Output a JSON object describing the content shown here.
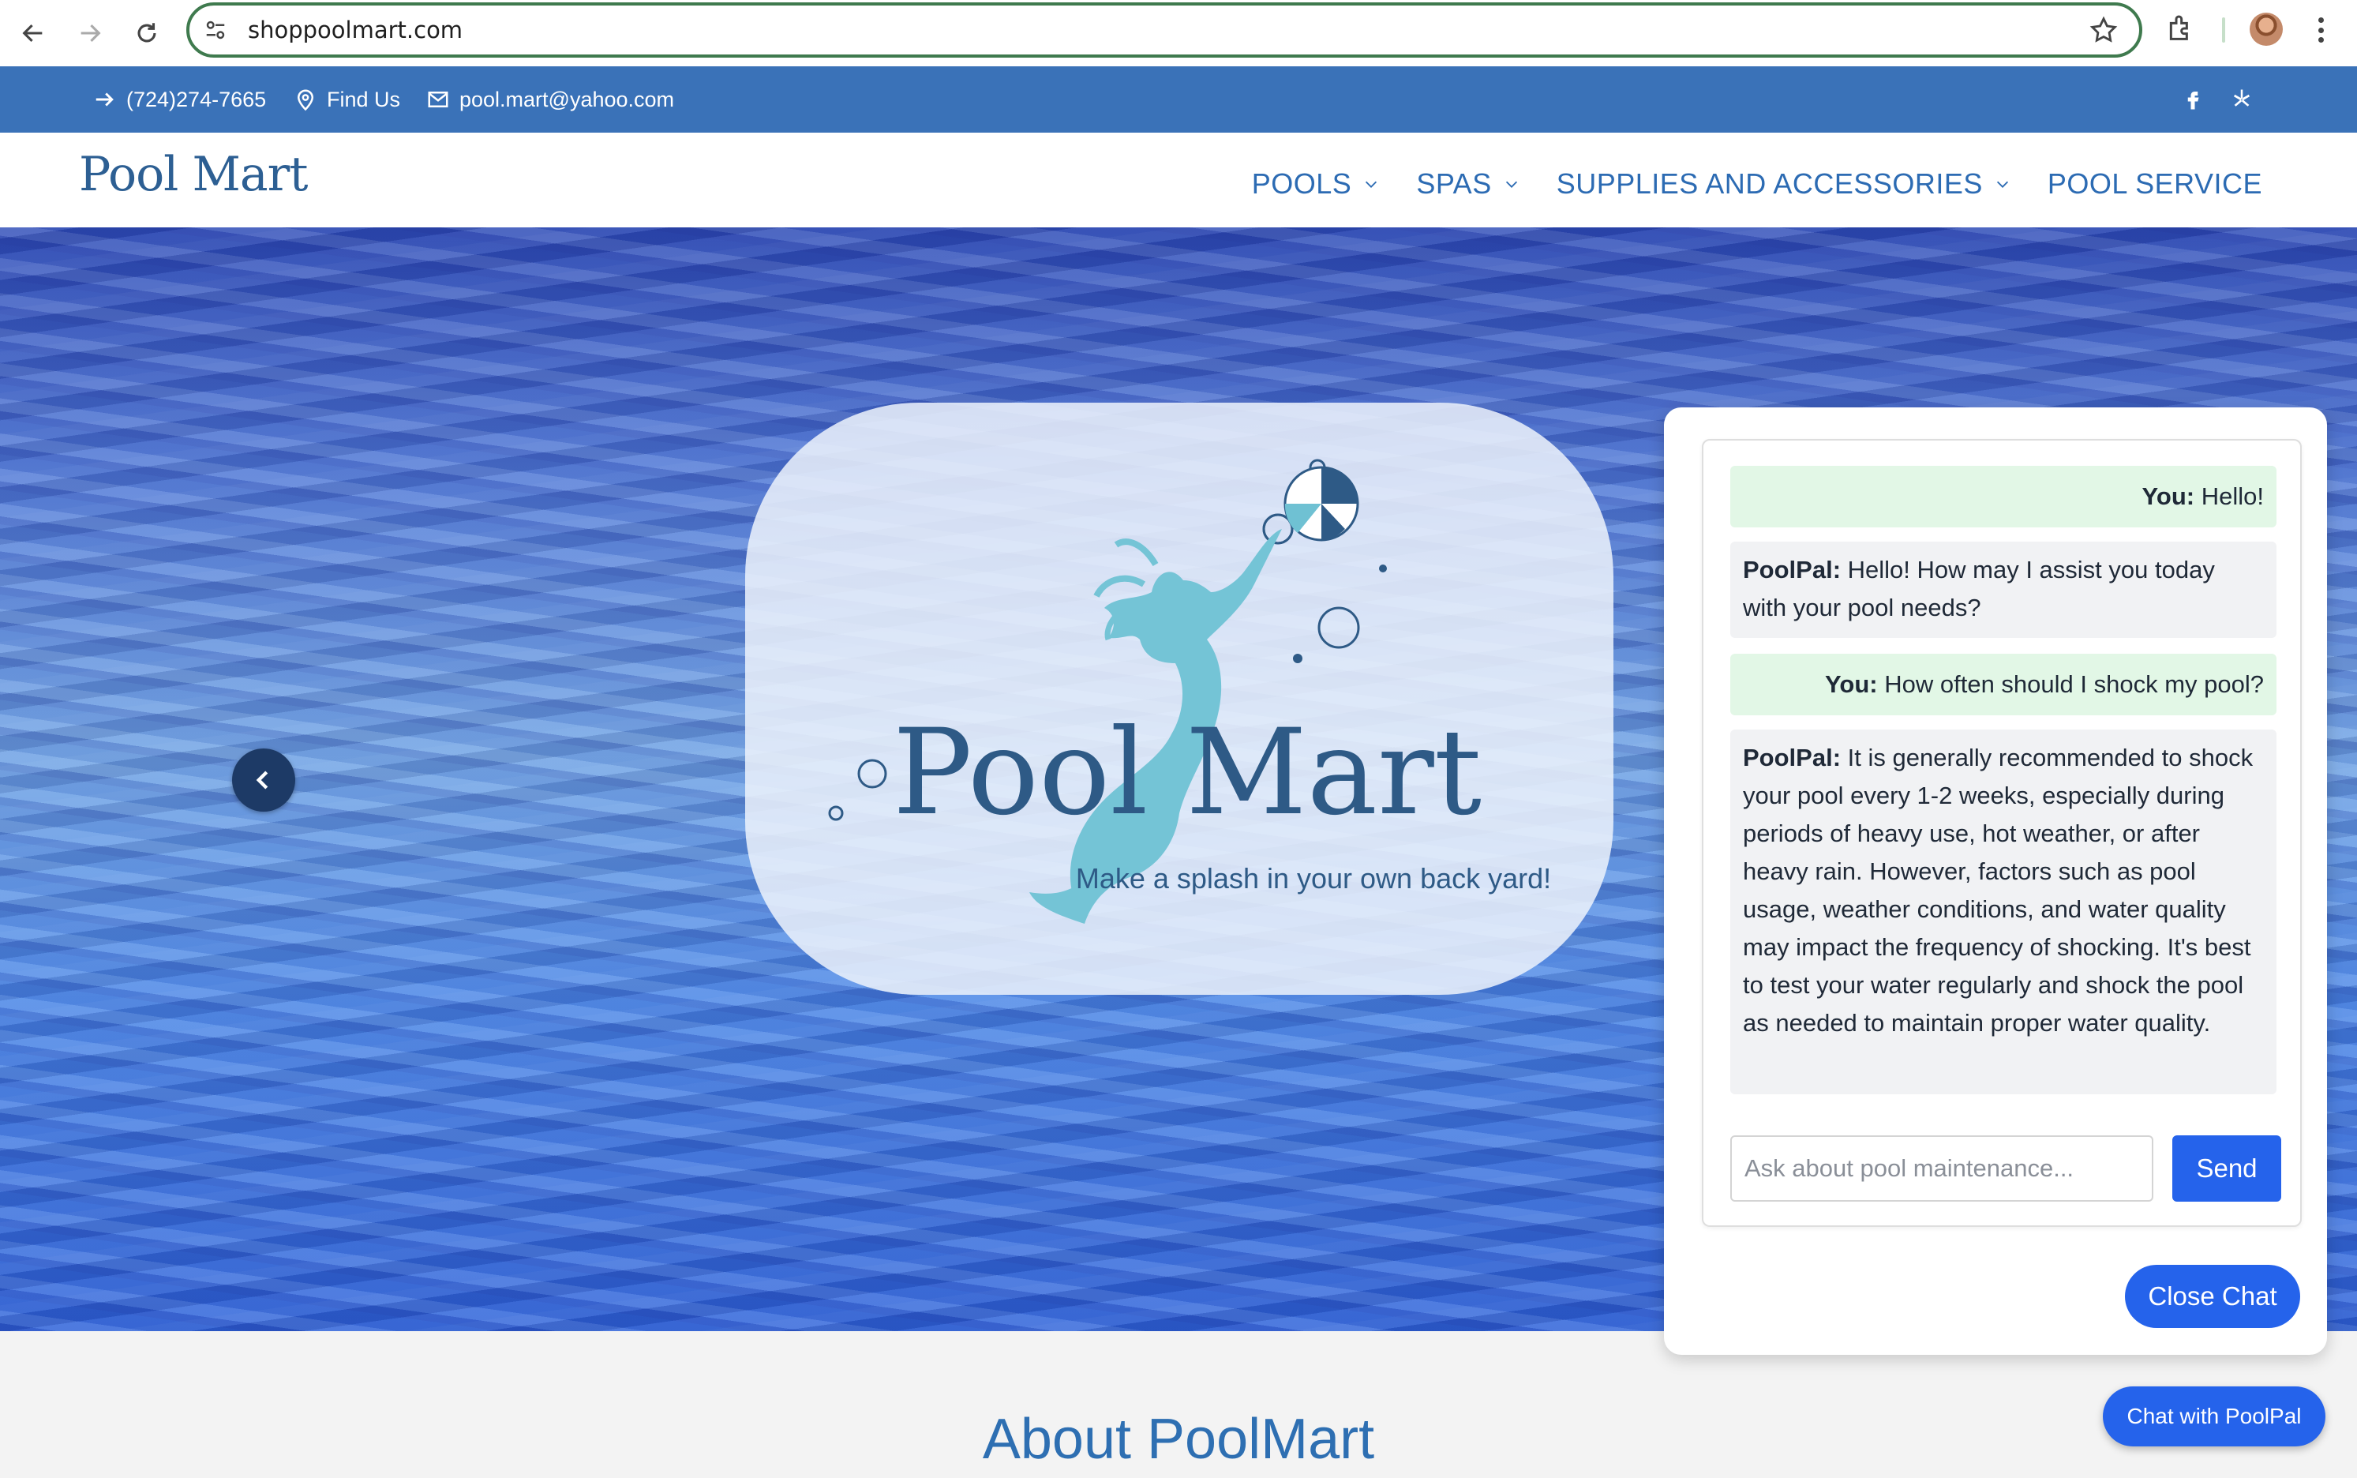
{
  "browser": {
    "url": "shoppoolmart.com",
    "icons": [
      "back-icon",
      "forward-icon",
      "reload-icon",
      "site-settings-icon",
      "bookmark-star-icon",
      "extensions-icon",
      "profile-avatar",
      "menu-kebab-icon"
    ]
  },
  "infobar": {
    "phone": "(724)274-7665",
    "find_us": "Find Us",
    "email": "pool.mart@yahoo.com",
    "social": [
      "facebook-icon",
      "yelp-icon"
    ],
    "background": "#3a72b8"
  },
  "header": {
    "logo": "Pool Mart",
    "menu": [
      {
        "label": "POOLS",
        "dropdown": true
      },
      {
        "label": "SPAS",
        "dropdown": true
      },
      {
        "label": "SUPPLIES AND ACCESSORIES",
        "dropdown": true
      },
      {
        "label": "POOL SERVICE",
        "dropdown": false
      }
    ],
    "menu_color": "#2c6bb3"
  },
  "hero": {
    "brand": "Pool Mart",
    "tagline": "Make a splash in your own back yard!"
  },
  "about": {
    "title": "About PoolMart"
  },
  "chat": {
    "messages": [
      {
        "sender": "You:",
        "text": "Hello!",
        "role": "user"
      },
      {
        "sender": "PoolPal:",
        "text": "Hello! How may I assist you today with your pool needs?",
        "role": "bot"
      },
      {
        "sender": "You:",
        "text": "How often should I shock my pool?",
        "role": "user"
      },
      {
        "sender": "PoolPal:",
        "text": "It is generally recommended to shock your pool every 1-2 weeks, especially during periods of heavy use, hot weather, or after heavy rain. However, factors such as pool usage, weather conditions, and water quality may impact the frequency of shocking. It's best to test your water regularly and shock the pool as needed to maintain proper water quality.",
        "role": "bot"
      }
    ],
    "input_placeholder": "Ask about pool maintenance...",
    "input_value": "",
    "send_label": "Send",
    "close_label": "Close Chat",
    "open_label": "Chat with PoolPal",
    "accent": "#2563eb"
  }
}
